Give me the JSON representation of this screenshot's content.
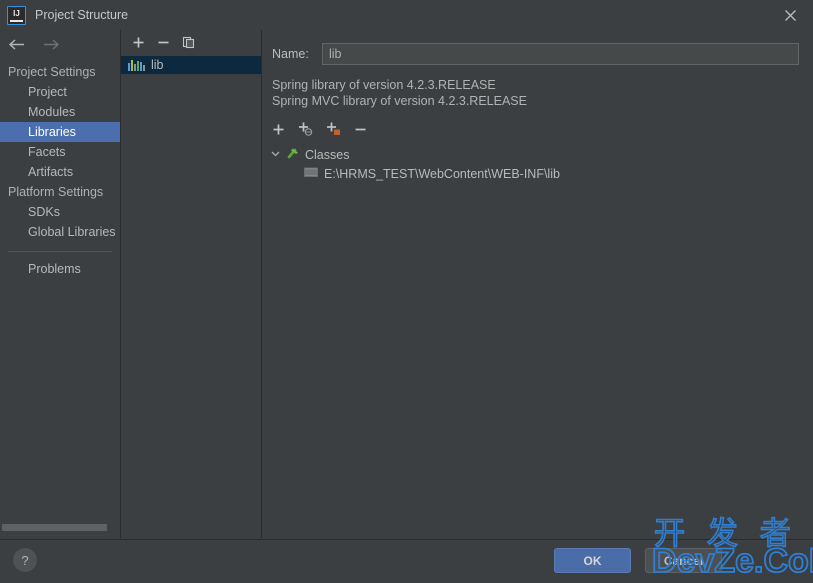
{
  "window": {
    "title": "Project Structure",
    "app_icon": "intellij-idea-icon",
    "close_icon": "close-icon"
  },
  "nav": {
    "back_icon": "arrow-left-icon",
    "forward_icon": "arrow-right-icon"
  },
  "sidebar": {
    "groups": [
      {
        "label": "Project Settings",
        "items": [
          {
            "label": "Project",
            "selected": false
          },
          {
            "label": "Modules",
            "selected": false
          },
          {
            "label": "Libraries",
            "selected": true
          },
          {
            "label": "Facets",
            "selected": false
          },
          {
            "label": "Artifacts",
            "selected": false
          }
        ]
      },
      {
        "label": "Platform Settings",
        "items": [
          {
            "label": "SDKs",
            "selected": false
          },
          {
            "label": "Global Libraries",
            "selected": false
          }
        ]
      }
    ],
    "problems_label": "Problems"
  },
  "library_panel": {
    "toolbar": [
      {
        "name": "add-library-button",
        "glyph": "plus-icon"
      },
      {
        "name": "remove-library-button",
        "glyph": "minus-icon"
      },
      {
        "name": "copy-library-button",
        "glyph": "copy-icon"
      }
    ],
    "items": [
      {
        "label": "lib",
        "icon": "library-icon",
        "selected": true
      }
    ]
  },
  "detail": {
    "name_label": "Name:",
    "name_value": "lib",
    "name_placeholder": "",
    "descriptions": [
      "Spring library of version 4.2.3.RELEASE",
      "Spring MVC library of version 4.2.3.RELEASE"
    ],
    "roots_toolbar": [
      {
        "name": "add-root-button",
        "glyph": "plus-icon"
      },
      {
        "name": "add-from-maven-button",
        "glyph": "plus-globe-icon"
      },
      {
        "name": "add-from-directory-button",
        "glyph": "plus-folder-icon"
      },
      {
        "name": "remove-root-button",
        "glyph": "minus-icon"
      }
    ],
    "tree": {
      "expander": "chevron-down-icon",
      "node_icon": "classes-hammer-icon",
      "node_label": "Classes",
      "children": [
        {
          "icon": "archive-folder-icon",
          "label": "E:\\HRMS_TEST\\WebContent\\WEB-INF\\lib"
        }
      ]
    }
  },
  "bottom": {
    "help_label": "?",
    "ok_label": "OK",
    "cancel_label": "Cancel"
  },
  "watermark": {
    "line_cn": "开 发 者",
    "line_en": "DevZe.CoM",
    "color": "#2f7fd4"
  },
  "colors": {
    "background": "#3c3f41",
    "selection": "#4b6eaf",
    "list_selection": "#0d293f",
    "ok_button": "#4a6da7",
    "border": "#2b2b2b"
  }
}
